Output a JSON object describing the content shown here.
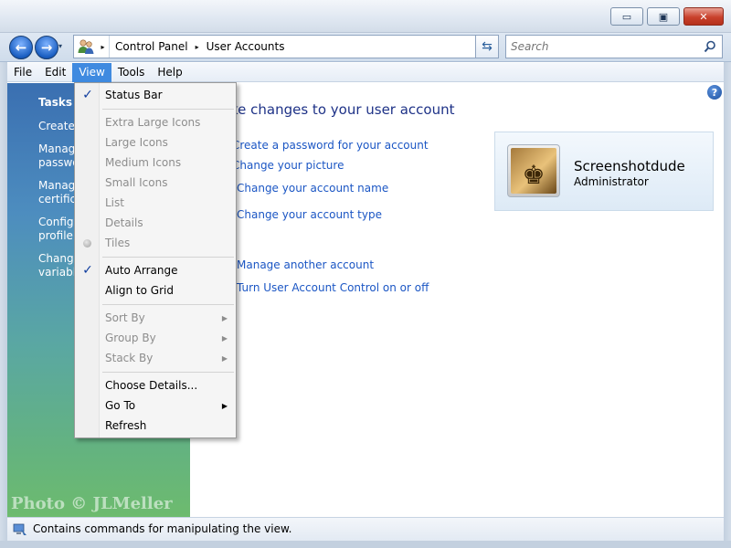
{
  "window": {
    "minimize_glyph": "▭",
    "maximize_glyph": "▣",
    "close_glyph": "✕"
  },
  "nav": {
    "back_glyph": "←",
    "forward_glyph": "→",
    "dropdown_glyph": "▾"
  },
  "address": {
    "breadcrumbs": [
      "Control Panel",
      "User Accounts"
    ],
    "separator_glyph": "▸",
    "dropdown_glyph": "▾",
    "refresh_glyph": "⇆"
  },
  "search": {
    "placeholder": "Search"
  },
  "menubar": {
    "items": [
      "File",
      "Edit",
      "View",
      "Tools",
      "Help"
    ],
    "active": "View"
  },
  "taskpane": {
    "title": "Tasks",
    "links": [
      "Create",
      "Manag\npasswo",
      "Manag\ncertifica",
      "Configu\nprofile",
      "Change\nvariable"
    ]
  },
  "content": {
    "help_glyph": "?",
    "heading": "ke changes to your user account",
    "links": [
      "Create a password for your account",
      "Change your picture",
      "Change your account name",
      "Change your account type",
      "Manage another account",
      "Turn User Account Control on or off"
    ],
    "user": {
      "name": "Screenshotdude",
      "role": "Administrator",
      "picture_glyph": "♚"
    }
  },
  "view_menu": {
    "check_glyph": "✓",
    "submenu_glyph": "▶",
    "items": [
      {
        "label": "Status Bar",
        "checked": true,
        "disabled": false
      },
      {
        "label": "Extra Large Icons",
        "disabled": true
      },
      {
        "label": "Large Icons",
        "disabled": true
      },
      {
        "label": "Medium Icons",
        "disabled": true
      },
      {
        "label": "Small Icons",
        "disabled": true
      },
      {
        "label": "List",
        "disabled": true
      },
      {
        "label": "Details",
        "disabled": true
      },
      {
        "label": "Tiles",
        "disabled": true,
        "radio": true
      },
      {
        "label": "Auto Arrange",
        "checked": true,
        "disabled": false
      },
      {
        "label": "Align to Grid",
        "disabled": false
      },
      {
        "label": "Sort By",
        "disabled": true,
        "submenu": true
      },
      {
        "label": "Group By",
        "disabled": true,
        "submenu": true
      },
      {
        "label": "Stack By",
        "disabled": true,
        "submenu": true
      },
      {
        "label": "Choose Details...",
        "disabled": false
      },
      {
        "label": "Go To",
        "disabled": false,
        "submenu": true
      },
      {
        "label": "Refresh",
        "disabled": false
      }
    ]
  },
  "statusbar": {
    "text": "Contains commands for manipulating the view."
  },
  "watermark": {
    "text": "Photo © JLMeller"
  },
  "colors": {
    "link": "#1b56c4",
    "heading": "#1e3287",
    "menu_highlight": "#3f8ae0",
    "close_button": "#c8412c"
  }
}
